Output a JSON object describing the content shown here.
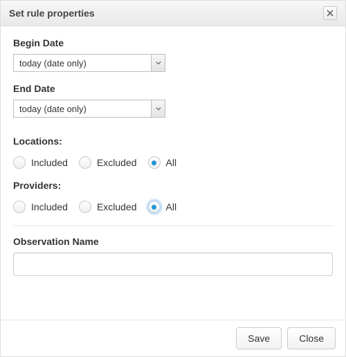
{
  "dialog": {
    "title": "Set rule properties"
  },
  "fields": {
    "begin_date": {
      "label": "Begin Date",
      "value": "today (date only)"
    },
    "end_date": {
      "label": "End Date",
      "value": "today (date only)"
    },
    "locations": {
      "label": "Locations:",
      "options": {
        "included": "Included",
        "excluded": "Excluded",
        "all": "All"
      },
      "selected": "all"
    },
    "providers": {
      "label": "Providers:",
      "options": {
        "included": "Included",
        "excluded": "Excluded",
        "all": "All"
      },
      "selected": "all"
    },
    "observation_name": {
      "label": "Observation Name",
      "value": ""
    }
  },
  "footer": {
    "save": "Save",
    "close": "Close"
  }
}
